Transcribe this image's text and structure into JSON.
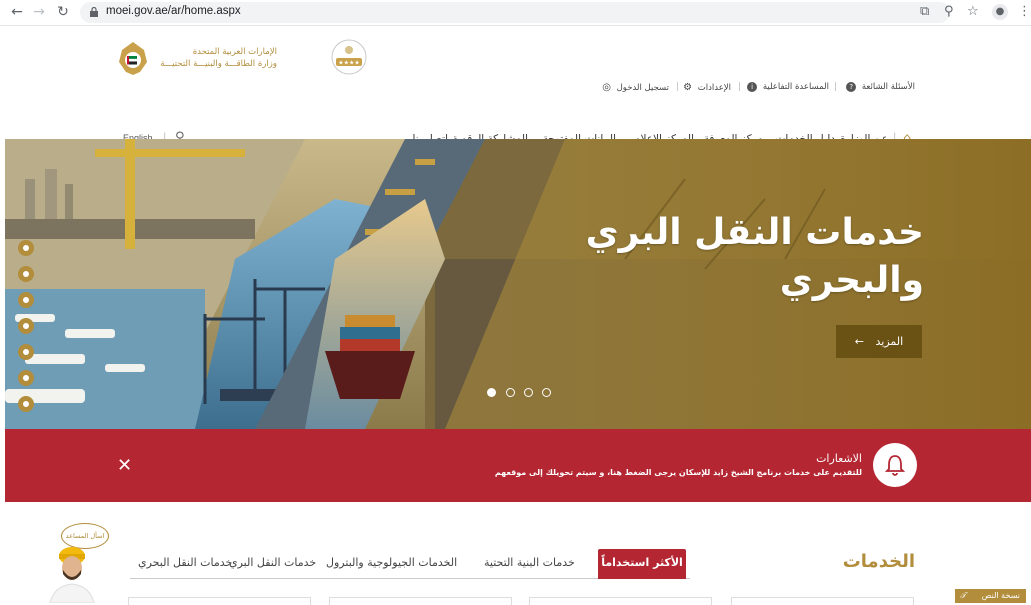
{
  "browser": {
    "url": "moei.gov.ae/ar/home.aspx"
  },
  "header": {
    "org_name_line1": "الإمارات العربية المتحدة",
    "org_name_line2": "وزارة الطاقـــة والبنيـــة التحتيـــة",
    "utility_links": [
      {
        "label": "الأسئلة الشائعة",
        "icon": "question-icon"
      },
      {
        "label": "المساعدة التفاعلية",
        "icon": "info-icon"
      },
      {
        "label": "الإعدادات",
        "icon": "gear-icon"
      },
      {
        "label": "تسجيل الدخول",
        "icon": "user-icon"
      }
    ],
    "nav_items": [
      "عن الوزارة",
      "دليل الخدمات",
      "مركز المعرفة",
      "المركز الإعلامي",
      "البيانات المفتوحة",
      "المشاركة الرقمية",
      "اتصل بنا"
    ],
    "language_link": "English"
  },
  "hero": {
    "title_line1": "خدمات النقل البري",
    "title_line2": "والبحري",
    "more_button": "المزيد",
    "slides_count": 4,
    "active_slide": 1,
    "overlay_color": "#9a7a2e"
  },
  "alert": {
    "title": "الاشعارات",
    "message": "للتقديم على خدمات برنامج الشيخ زايد للإسكان يرجى الضغط هنا، و سيتم تحويلك إلى موقعهم",
    "background": "#b32632"
  },
  "services": {
    "heading": "الخدمات",
    "tabs": [
      "الأكثر استخداماً",
      "خدمات البنية التحتية",
      "الخدمات الجيولوجية والبترول",
      "خدمات النقل البري",
      "خدمات النقل البحري"
    ],
    "active_tab": 0,
    "accent_color": "#b32632"
  },
  "assistant": {
    "bubble_text": "اسأل المساعد"
  },
  "text_version_badge": {
    "label": "نسخة النص"
  },
  "colors": {
    "gold": "#b28d3c",
    "text_dark": "#333333"
  }
}
